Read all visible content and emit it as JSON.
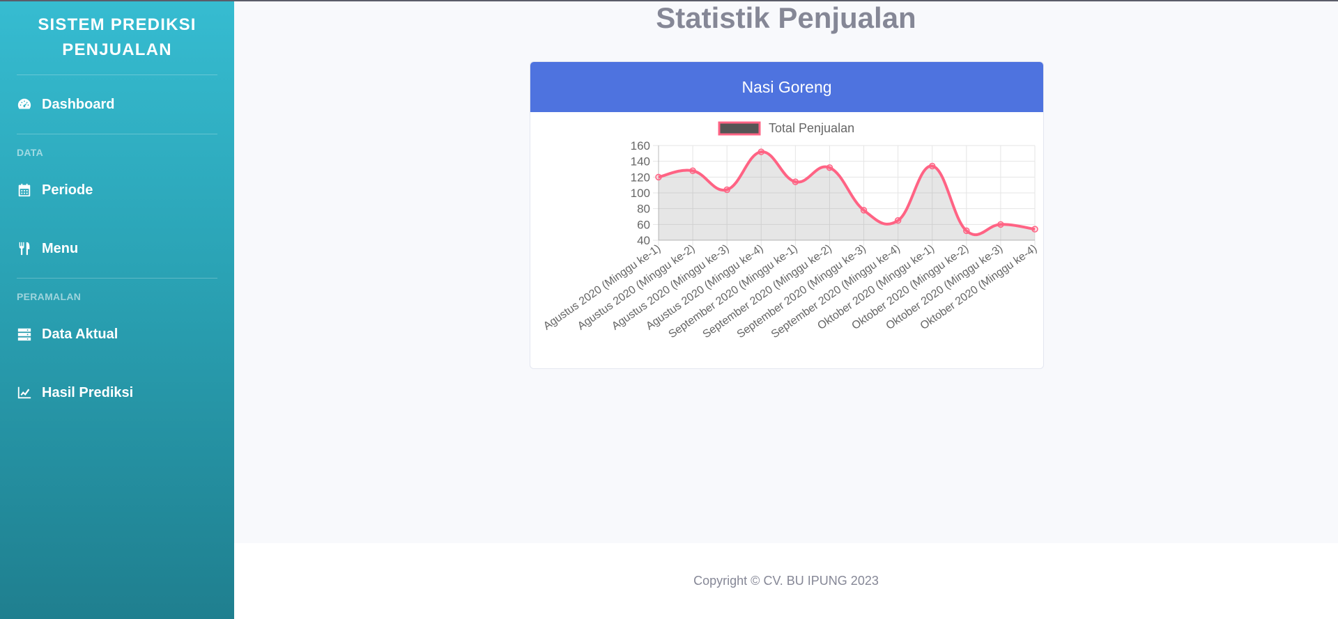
{
  "sidebar": {
    "brand": "SISTEM PREDIKSI PENJUALAN",
    "items": [
      {
        "label": "Dashboard",
        "icon": "tachometer-icon"
      },
      {
        "label": "Periode",
        "icon": "calendar-icon"
      },
      {
        "label": "Menu",
        "icon": "utensils-icon"
      },
      {
        "label": "Data Aktual",
        "icon": "server-icon"
      },
      {
        "label": "Hasil Prediksi",
        "icon": "chart-line-icon"
      }
    ],
    "headings": [
      "DATA",
      "PERAMALAN"
    ]
  },
  "main": {
    "title": "Statistik Penjualan",
    "card_title": "Nasi Goreng"
  },
  "footer": {
    "copyright": "Copyright © CV. BU IPUNG 2023"
  },
  "colors": {
    "line": "#ff6384",
    "fill": "rgba(128,128,128,0.2)",
    "card_header": "#4e73df"
  },
  "chart_data": {
    "type": "line",
    "legend": "Total Penjualan",
    "categories": [
      "Agustus 2020 (Minggu ke-1)",
      "Agustus 2020 (Minggu ke-2)",
      "Agustus 2020 (Minggu ke-3)",
      "Agustus 2020 (Minggu ke-4)",
      "September 2020 (Minggu ke-1)",
      "September 2020 (Minggu ke-2)",
      "September 2020 (Minggu ke-3)",
      "September 2020 (Minggu ke-4)",
      "Oktober 2020 (Minggu ke-1)",
      "Oktober 2020 (Minggu ke-2)",
      "Oktober 2020 (Minggu ke-3)",
      "Oktober 2020 (Minggu ke-4)"
    ],
    "series": [
      {
        "name": "Total Penjualan",
        "values": [
          120,
          128,
          104,
          152,
          114,
          132,
          78,
          65,
          134,
          52,
          60,
          54
        ]
      }
    ],
    "ylim": [
      40,
      160
    ],
    "yticks": [
      40,
      60,
      80,
      100,
      120,
      140,
      160
    ],
    "grid": true,
    "legend_position": "top"
  }
}
